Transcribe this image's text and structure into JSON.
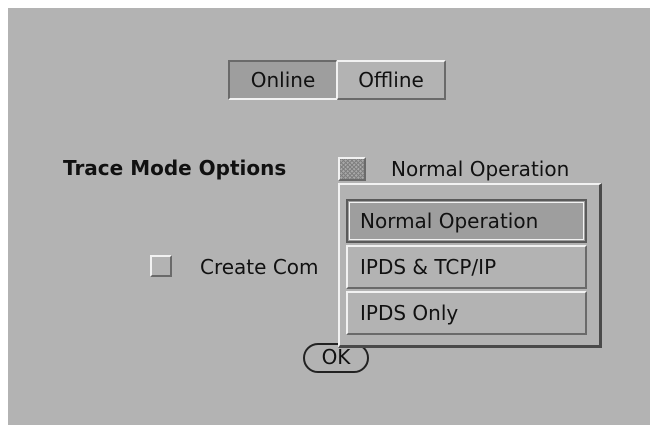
{
  "mode_toggle": {
    "online_label": "Online",
    "offline_label": "Offline",
    "selected": "Online"
  },
  "trace_mode": {
    "label": "Trace Mode Options",
    "current_value": "Normal Operation",
    "options": [
      "Normal Operation",
      "IPDS & TCP/IP",
      "IPDS Only"
    ],
    "highlighted_option": "Normal Operation"
  },
  "create_checkbox": {
    "label_visible": "Create Com",
    "checked": false
  },
  "ok_button": {
    "label": "OK"
  },
  "colors": {
    "panel_bg": "#b3b3b3",
    "selected_bg": "#9e9e9e",
    "highlight": "#f2f2f2",
    "shadow": "#6a6a6a"
  }
}
